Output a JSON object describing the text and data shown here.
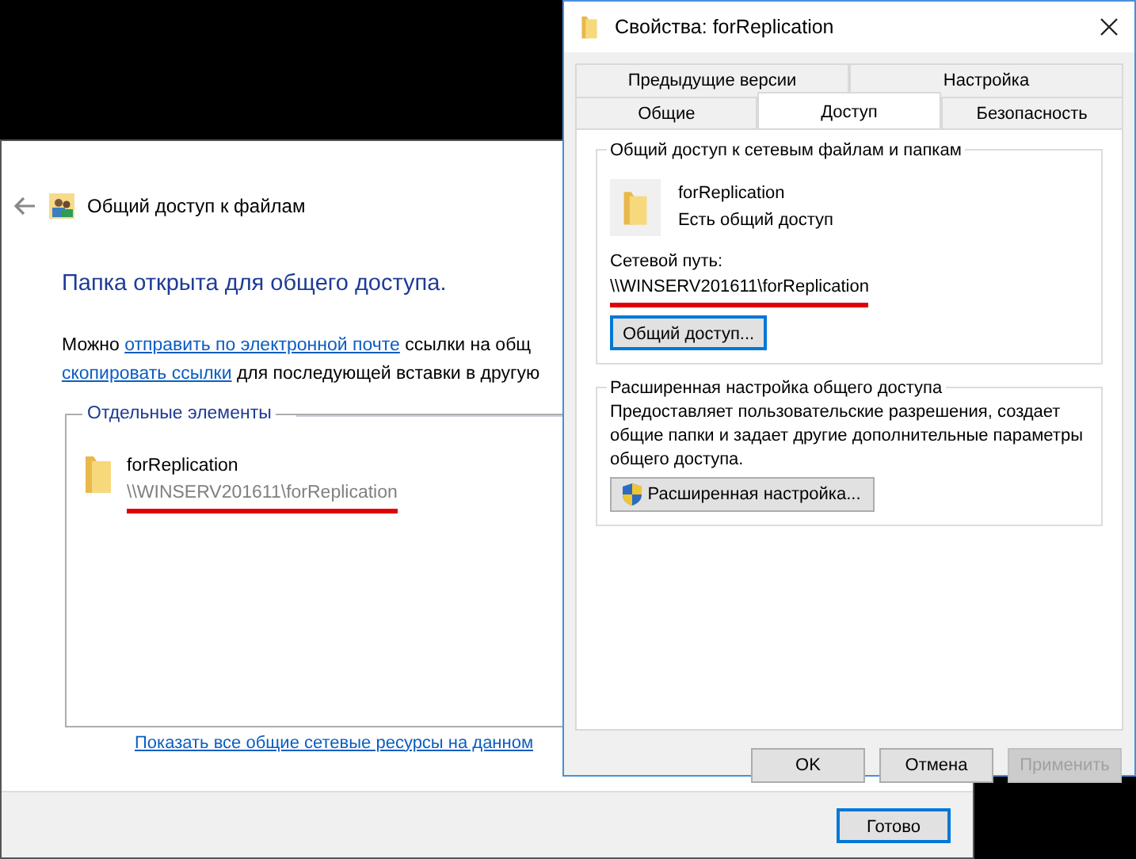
{
  "back_window": {
    "title": "Общий доступ к файлам",
    "heading": "Папка открыта для общего доступа.",
    "intro_lines": [
      [
        {
          "kind": "text",
          "text": "Можно "
        },
        {
          "kind": "link",
          "text": "отправить по электронной почте"
        },
        {
          "kind": "text",
          "text": " ссылки на общ"
        }
      ],
      [
        {
          "kind": "link",
          "text": "скопировать ссылки"
        },
        {
          "kind": "text",
          "text": " для последующей вставки в другую"
        }
      ]
    ],
    "group": {
      "legend": "Отдельные элементы",
      "items": [
        {
          "name": "forReplication",
          "path": "\\\\WINSERV201611\\forReplication",
          "highlighted": true
        }
      ]
    },
    "link": "Показать все общие сетевые ресурсы на данном",
    "buttons": [
      {
        "label": "Готово",
        "focused": true
      }
    ]
  },
  "properties": {
    "title": "Свойства: forReplication",
    "tab_rows": [
      [
        {
          "label": "Предыдущие версии",
          "selected": false
        },
        {
          "label": "Настройка",
          "selected": false
        }
      ],
      [
        {
          "label": "Общие",
          "selected": false
        },
        {
          "label": "Доступ",
          "selected": true
        },
        {
          "label": "Безопасность",
          "selected": false
        }
      ]
    ],
    "share_group": {
      "legend": "Общий доступ к сетевым файлам и папкам",
      "name": "forReplication",
      "status": "Есть общий доступ",
      "path_label": "Сетевой путь:",
      "path": "\\\\WINSERV201611\\forReplication",
      "path_highlighted": true,
      "button": {
        "label": "Общий доступ...",
        "focused": true
      }
    },
    "advanced_group": {
      "legend": "Расширенная настройка общего доступа",
      "description": "Предоставляет пользовательские разрешения, создает общие папки и задает другие дополнительные параметры общего доступа.",
      "button": {
        "label": "Расширенная настройка...",
        "focused": false
      }
    },
    "buttons": [
      {
        "label": "OK",
        "disabled": false
      },
      {
        "label": "Отмена",
        "disabled": false
      },
      {
        "label": "Применить",
        "disabled": true
      }
    ]
  }
}
